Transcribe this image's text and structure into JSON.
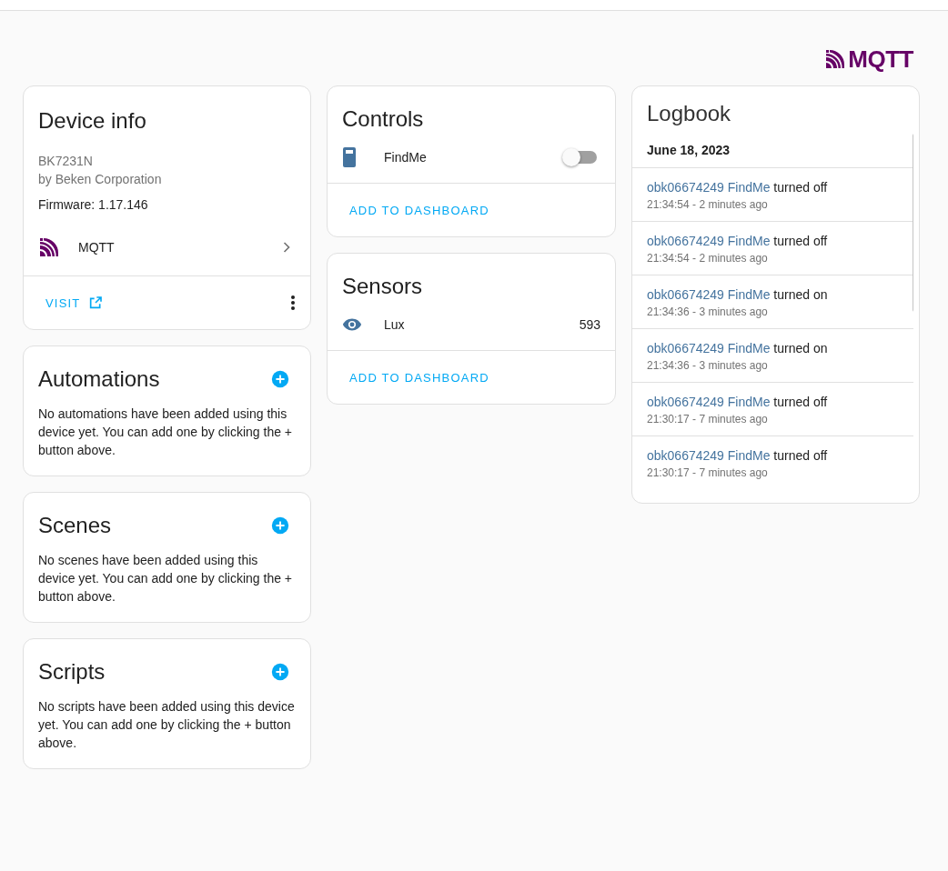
{
  "header": {
    "logo": "MQTT"
  },
  "device_info": {
    "title": "Device info",
    "model": "BK7231N",
    "manufacturer": "by Beken Corporation",
    "firmware": "Firmware: 1.17.146",
    "integration": "MQTT",
    "visit": "VISIT"
  },
  "automations": {
    "title": "Automations",
    "text": "No automations have been added using this device yet. You can add one by clicking the + button above."
  },
  "scenes": {
    "title": "Scenes",
    "text": "No scenes have been added using this device yet. You can add one by clicking the + button above."
  },
  "scripts": {
    "title": "Scripts",
    "text": "No scripts have been added using this device yet. You can add one by clicking the + button above."
  },
  "controls": {
    "title": "Controls",
    "items": [
      {
        "name": "FindMe",
        "on": false
      }
    ],
    "action": "ADD TO DASHBOARD"
  },
  "sensors": {
    "title": "Sensors",
    "items": [
      {
        "name": "Lux",
        "value": "593"
      }
    ],
    "action": "ADD TO DASHBOARD"
  },
  "logbook": {
    "title": "Logbook",
    "date": "June 18, 2023",
    "entries": [
      {
        "device": "obk06674249",
        "entity": "FindMe",
        "action": "turned off",
        "time": "21:34:54 - 2 minutes ago"
      },
      {
        "device": "obk06674249",
        "entity": "FindMe",
        "action": "turned off",
        "time": "21:34:54 - 2 minutes ago"
      },
      {
        "device": "obk06674249",
        "entity": "FindMe",
        "action": "turned on",
        "time": "21:34:36 - 3 minutes ago"
      },
      {
        "device": "obk06674249",
        "entity": "FindMe",
        "action": "turned on",
        "time": "21:34:36 - 3 minutes ago"
      },
      {
        "device": "obk06674249",
        "entity": "FindMe",
        "action": "turned off",
        "time": "21:30:17 - 7 minutes ago"
      },
      {
        "device": "obk06674249",
        "entity": "FindMe",
        "action": "turned off",
        "time": "21:30:17 - 7 minutes ago"
      }
    ]
  }
}
